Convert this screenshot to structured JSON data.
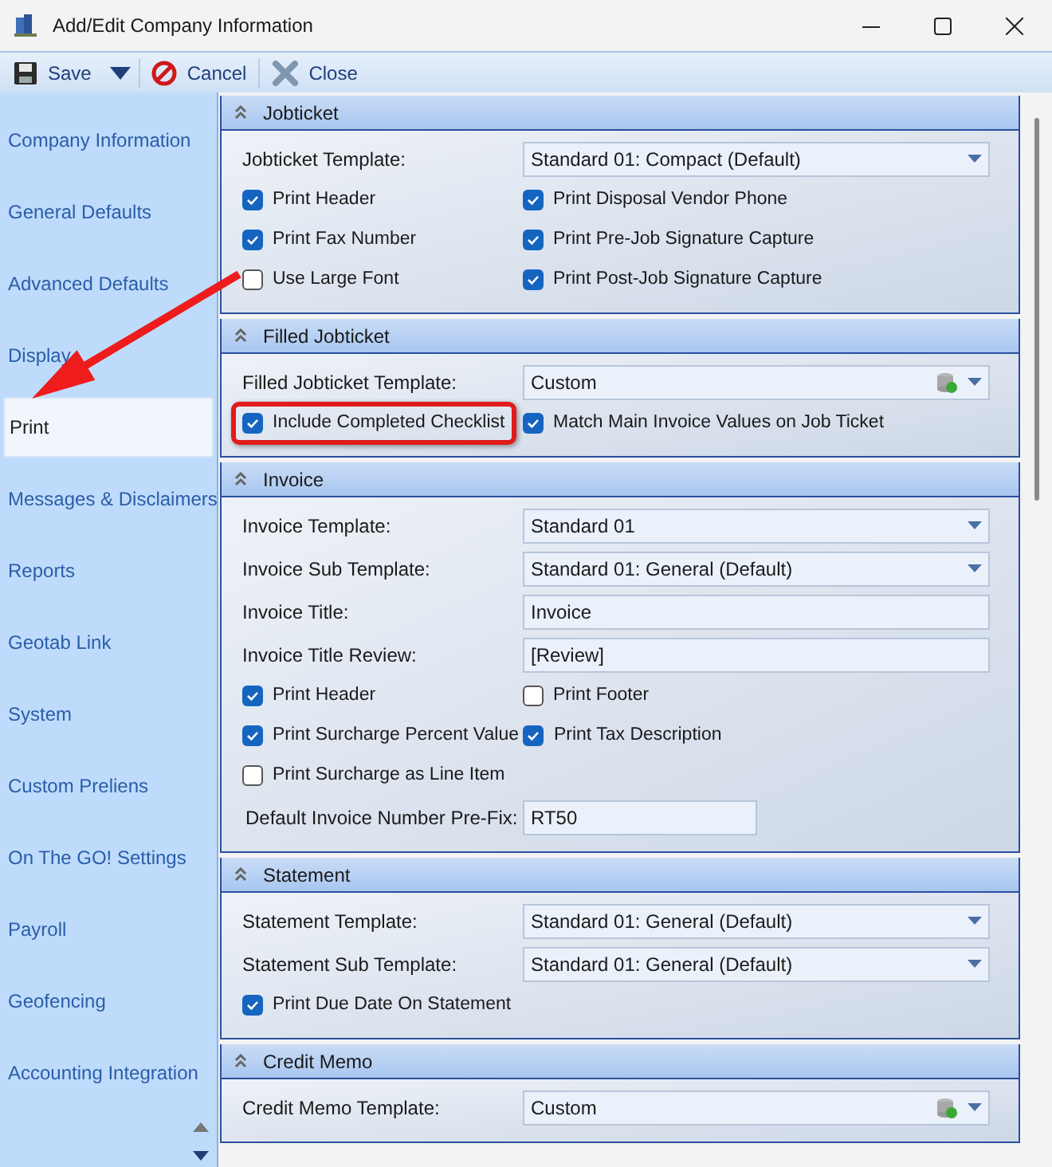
{
  "window": {
    "title": "Add/Edit Company Information"
  },
  "toolbar": [
    {
      "kind": "save",
      "label": "Save"
    },
    {
      "kind": "cancel",
      "label": "Cancel"
    },
    {
      "kind": "close",
      "label": "Close"
    }
  ],
  "sidebar": {
    "items": [
      {
        "label": "Company Information",
        "selected": false
      },
      {
        "label": "General Defaults",
        "selected": false
      },
      {
        "label": "Advanced Defaults",
        "selected": false
      },
      {
        "label": "Display",
        "selected": false
      },
      {
        "label": "Print",
        "selected": true
      },
      {
        "label": "Messages & Disclaimers",
        "selected": false
      },
      {
        "label": "Reports",
        "selected": false
      },
      {
        "label": "Geotab Link",
        "selected": false
      },
      {
        "label": "System",
        "selected": false
      },
      {
        "label": "Custom Preliens",
        "selected": false
      },
      {
        "label": "On The GO! Settings",
        "selected": false
      },
      {
        "label": "Payroll",
        "selected": false
      },
      {
        "label": "Geofencing",
        "selected": false
      },
      {
        "label": "Accounting Integration",
        "selected": false
      }
    ]
  },
  "pointer_arrow": true,
  "sections": [
    {
      "title": "Jobticket",
      "rows": [
        {
          "kind": "select",
          "label": "Jobticket Template:",
          "value": "Standard 01: Compact (Default)",
          "custom_icon": false
        },
        {
          "kind": "checks",
          "items": [
            {
              "label": "Print Header",
              "checked": true,
              "highlighted": false
            },
            {
              "label": "Print Disposal Vendor Phone",
              "checked": true,
              "highlighted": false
            }
          ]
        },
        {
          "kind": "checks",
          "items": [
            {
              "label": "Print Fax Number",
              "checked": true,
              "highlighted": false
            },
            {
              "label": "Print Pre-Job Signature Capture",
              "checked": true,
              "highlighted": false
            }
          ]
        },
        {
          "kind": "checks",
          "items": [
            {
              "label": "Use Large Font",
              "checked": false,
              "highlighted": false
            },
            {
              "label": "Print Post-Job Signature Capture",
              "checked": true,
              "highlighted": false
            }
          ]
        }
      ]
    },
    {
      "title": "Filled Jobticket",
      "rows": [
        {
          "kind": "select",
          "label": "Filled Jobticket Template:",
          "value": "Custom",
          "custom_icon": true
        },
        {
          "kind": "checks",
          "items": [
            {
              "label": "Include Completed Checklist",
              "checked": true,
              "highlighted": true
            },
            {
              "label": "Match Main Invoice Values on Job Ticket",
              "checked": true,
              "highlighted": false
            }
          ]
        }
      ]
    },
    {
      "title": "Invoice",
      "rows": [
        {
          "kind": "select",
          "label": "Invoice Template:",
          "value": "Standard 01",
          "custom_icon": false
        },
        {
          "kind": "select",
          "label": "Invoice Sub Template:",
          "value": "Standard 01: General (Default)",
          "custom_icon": false
        },
        {
          "kind": "text",
          "label": "Invoice Title:",
          "value": "Invoice"
        },
        {
          "kind": "text",
          "label": "Invoice Title Review:",
          "value": "[Review]"
        },
        {
          "kind": "checks",
          "items": [
            {
              "label": "Print Header",
              "checked": true,
              "highlighted": false
            },
            {
              "label": "Print Footer",
              "checked": false,
              "highlighted": false
            }
          ]
        },
        {
          "kind": "checks",
          "items": [
            {
              "label": "Print Surcharge Percent Value",
              "checked": true,
              "highlighted": false
            },
            {
              "label": "Print Tax Description",
              "checked": true,
              "highlighted": false
            }
          ]
        },
        {
          "kind": "checks",
          "items": [
            {
              "label": "Print Surcharge as Line Item",
              "checked": false,
              "highlighted": false
            }
          ]
        },
        {
          "kind": "short_text",
          "label": "Default Invoice Number Pre-Fix:",
          "value": "RT50"
        }
      ]
    },
    {
      "title": "Statement",
      "rows": [
        {
          "kind": "select",
          "label": "Statement Template:",
          "value": "Standard 01: General (Default)",
          "custom_icon": false
        },
        {
          "kind": "select",
          "label": "Statement Sub Template:",
          "value": "Standard 01: General (Default)",
          "custom_icon": false
        },
        {
          "kind": "checks",
          "items": [
            {
              "label": "Print Due Date On Statement",
              "checked": true,
              "highlighted": false
            }
          ]
        }
      ]
    },
    {
      "title": "Credit Memo",
      "rows": [
        {
          "kind": "select",
          "label": "Credit Memo Template:",
          "value": "Custom",
          "custom_icon": true
        }
      ]
    }
  ]
}
